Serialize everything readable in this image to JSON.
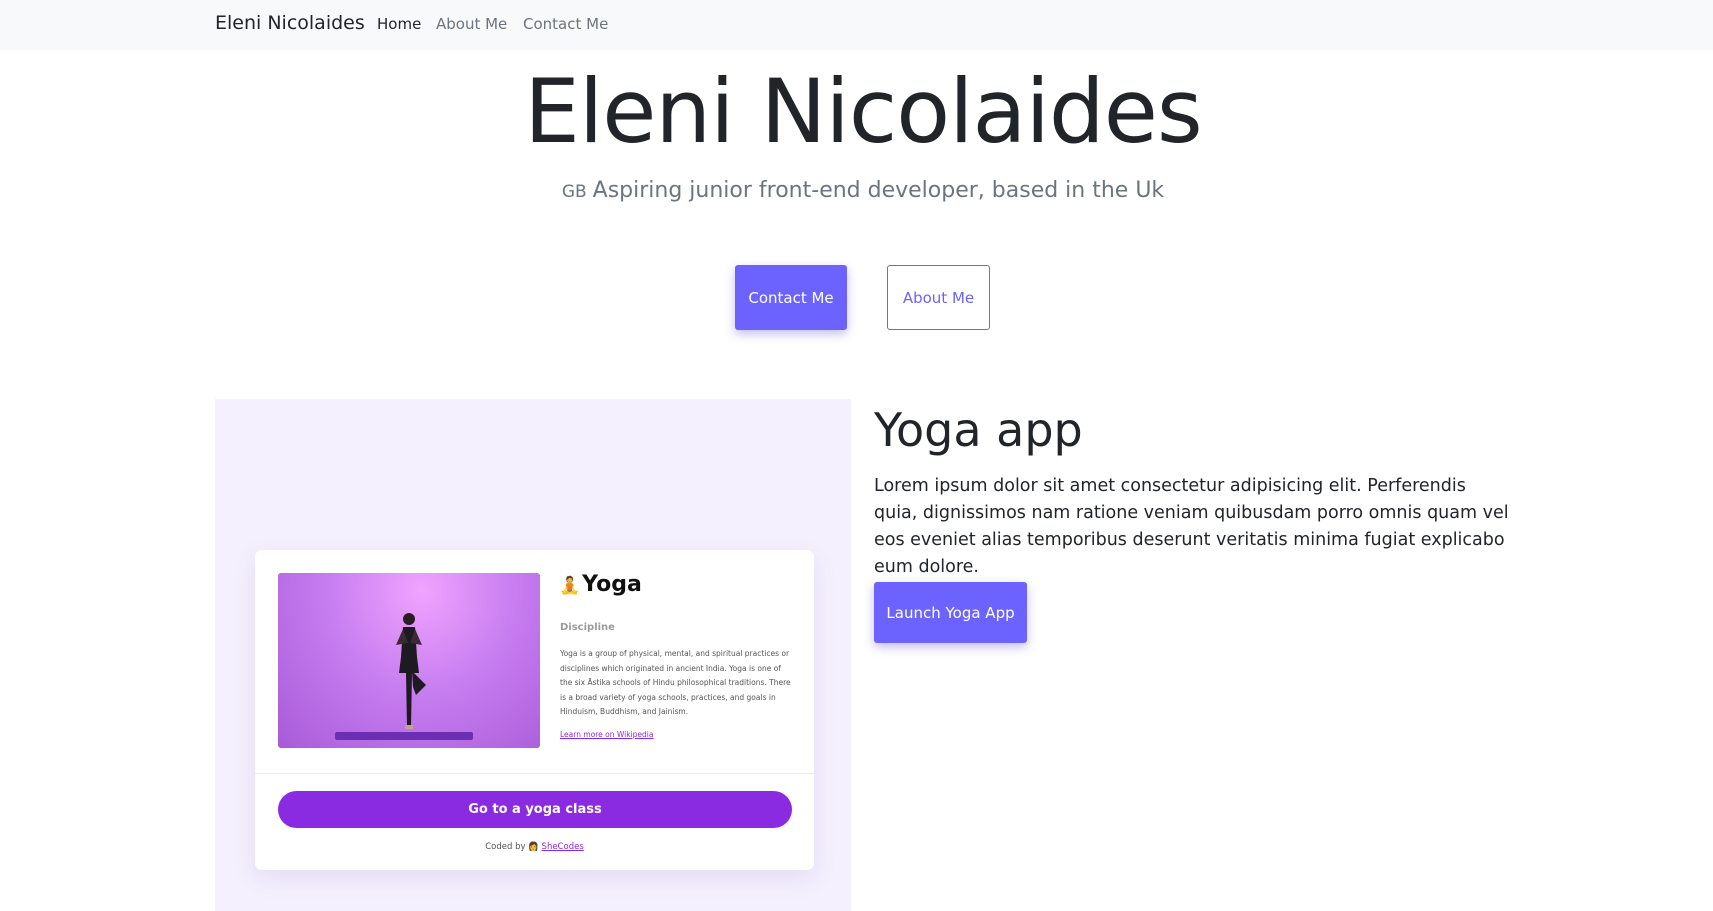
{
  "navbar": {
    "brand": "Eleni Nicolaides",
    "links": [
      {
        "label": "Home",
        "active": true
      },
      {
        "label": "About Me",
        "active": false
      },
      {
        "label": "Contact Me",
        "active": false
      }
    ]
  },
  "hero": {
    "title": "Eleni Nicolaides",
    "flag": "GB",
    "subtitle": "Aspiring junior front-end developer, based in the Uk",
    "contact_button": "Contact Me",
    "about_button": "About Me"
  },
  "project": {
    "title": "Yoga app",
    "description": "Lorem ipsum dolor sit amet consectetur adipisicing elit. Perferendis quia, dignissimos nam ratione veniam quibusdam porro omnis quam vel eos eveniet alias temporibus deserunt veritatis minima fugiat explicabo eum dolore.",
    "launch_button": "Launch Yoga App",
    "preview": {
      "emoji": "🧘",
      "title": "Yoga",
      "discipline": "Discipline",
      "description": "Yoga is a group of physical, mental, and spiritual practices or disciplines which originated in ancient India. Yoga is one of the six Āstika schools of Hindu philosophical traditions. There is a broad variety of yoga schools, practices, and goals in Hinduism, Buddhism, and Jainism.",
      "wiki_link": "Learn more on Wikipedia",
      "cta": "Go to a yoga class",
      "coded_by": "Coded by",
      "coded_emoji": "👩",
      "shecodes": "SheCodes"
    }
  },
  "colors": {
    "accent": "#6c63ff",
    "yoga_purple": "#8a2be2",
    "navbar_bg": "#f8f9fa",
    "project_bg": "#f4f0fd"
  }
}
